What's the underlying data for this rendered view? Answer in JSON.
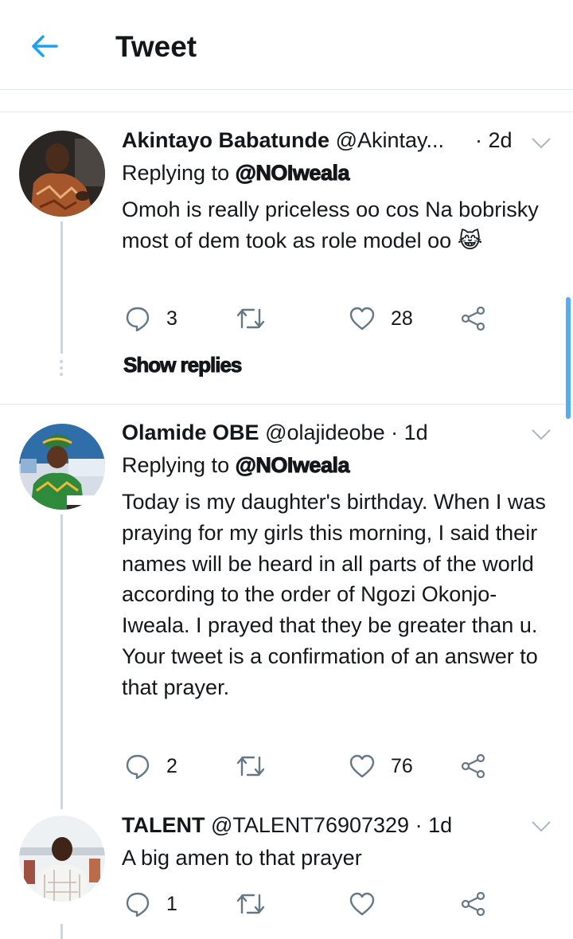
{
  "header": {
    "title": "Tweet"
  },
  "tweets": [
    {
      "name": "Akintayo Babatunde",
      "handle": "@Akintay...",
      "time": "· 2d",
      "replying_prefix": "Replying to ",
      "replying_to": "@NOIweala",
      "text": "Omoh is really priceless oo cos Na bobrisky most of dem took as role model oo 😹",
      "replies": "3",
      "retweets": "",
      "likes": "28",
      "show_replies": "Show replies"
    },
    {
      "name": "Olamide OBE",
      "handle": "@olajideobe",
      "time": "· 1d",
      "replying_prefix": "Replying to ",
      "replying_to": "@NOIweala",
      "text": "Today is my daughter's birthday. When I was praying for my girls this morning, I said their names will be heard in all parts of the world according to the order of Ngozi Okonjo-Iweala. I prayed that they be greater than u.\nYour tweet is a confirmation of an answer to that prayer.",
      "replies": "2",
      "retweets": "",
      "likes": "76"
    },
    {
      "name": "TALENT",
      "handle": "@TALENT76907329",
      "time": "· 1d",
      "text": "A big amen to that prayer",
      "replies": "1",
      "retweets": "",
      "likes": ""
    }
  ],
  "icons": {
    "back": "arrow-left-icon",
    "chevron": "chevron-down-icon",
    "reply": "speech-bubble-icon",
    "retweet": "retweet-icon",
    "like": "heart-icon",
    "share": "share-icon"
  },
  "colors": {
    "accent": "#1da1f2",
    "icon_gray": "#657786",
    "border": "#e1e8ed"
  }
}
